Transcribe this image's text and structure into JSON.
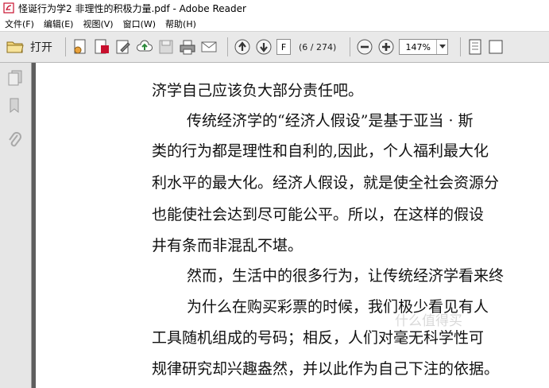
{
  "window": {
    "title": "怪诞行为学2 非理性的积极力量.pdf - Adobe Reader"
  },
  "menu": {
    "items": [
      "文件(F)",
      "编辑(E)",
      "视图(V)",
      "窗口(W)",
      "帮助(H)"
    ]
  },
  "toolbar": {
    "open_label": "打开",
    "page_input_value": "F",
    "page_count": "(6 / 274)",
    "zoom_value": "147%"
  },
  "document": {
    "lines": [
      "济学自己应该负大部分责任吧。",
      "传统经济学的“经济人假设”是基于亚当 · 斯",
      "类的行为都是理性和自利的,因此，个人福利最大化",
      "利水平的最大化。经济人假设，就是使全社会资源分",
      "也能使社会达到尽可能公平。所以，在这样的假设",
      "井有条而非混乱不堪。",
      "然而，生活中的很多行为，让传统经济学看来终",
      "为什么在购买彩票的时候，我们极少看见有人",
      "工具随机组成的号码；相反，人们对毫无科学性可",
      "规律研究却兴趣盎然，并以此作为自己下注的依据。"
    ],
    "watermark": "什么值得买"
  },
  "colors": {
    "toolbar_bg": "#e9e9e9",
    "doc_bg": "#5e5e5e",
    "app_icon_red": "#c8102e"
  }
}
